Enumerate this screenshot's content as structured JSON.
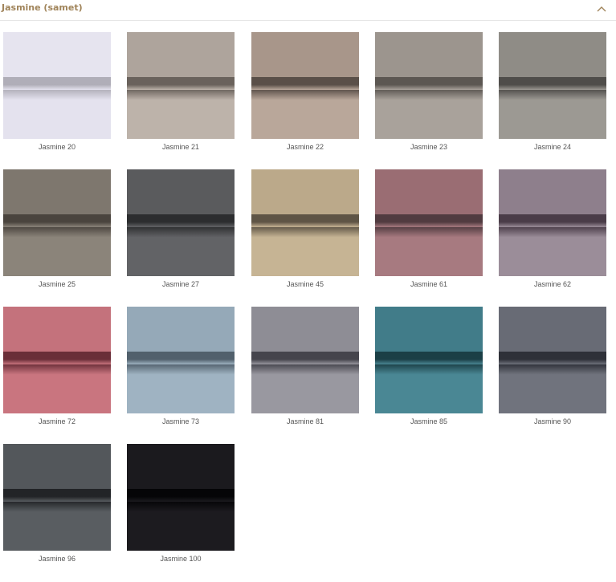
{
  "section": {
    "title": "Jasmine (samet)",
    "accent_color": "#a0845a",
    "collapse_icon": "chevron-up-icon"
  },
  "swatches": [
    {
      "label": "Jasmine 20",
      "top": "#e6e4ef",
      "band": "#b0aeb8",
      "bottom": "#e4e2ee"
    },
    {
      "label": "Jasmine 21",
      "top": "#aea49c",
      "band": "#6a625c",
      "bottom": "#bdb3aa"
    },
    {
      "label": "Jasmine 22",
      "top": "#a8968a",
      "band": "#5a4f48",
      "bottom": "#b9a79a"
    },
    {
      "label": "Jasmine 23",
      "top": "#9c958e",
      "band": "#5c5752",
      "bottom": "#a9a29b"
    },
    {
      "label": "Jasmine 24",
      "top": "#8f8c86",
      "band": "#4f4d4a",
      "bottom": "#9c9993"
    },
    {
      "label": "Jasmine 25",
      "top": "#7e776e",
      "band": "#4a443e",
      "bottom": "#8b847a"
    },
    {
      "label": "Jasmine 27",
      "top": "#5a5b5d",
      "band": "#2c2d2f",
      "bottom": "#626366"
    },
    {
      "label": "Jasmine 45",
      "top": "#bba98a",
      "band": "#5e5445",
      "bottom": "#c6b494"
    },
    {
      "label": "Jasmine 61",
      "top": "#9a6d73",
      "band": "#513b40",
      "bottom": "#a77a80"
    },
    {
      "label": "Jasmine 62",
      "top": "#8e7f8c",
      "band": "#4a3c48",
      "bottom": "#9b8d99"
    },
    {
      "label": "Jasmine 72",
      "top": "#c4727c",
      "band": "#6a2e38",
      "bottom": "#c9757f"
    },
    {
      "label": "Jasmine 73",
      "top": "#95a9b8",
      "band": "#51606c",
      "bottom": "#9fb3c2"
    },
    {
      "label": "Jasmine 81",
      "top": "#8e8d95",
      "band": "#45444c",
      "bottom": "#9998a0"
    },
    {
      "label": "Jasmine 85",
      "top": "#417c89",
      "band": "#1b3f46",
      "bottom": "#4a8794"
    },
    {
      "label": "Jasmine 90",
      "top": "#686b75",
      "band": "#2e3038",
      "bottom": "#70737d"
    },
    {
      "label": "Jasmine 96",
      "top": "#53575b",
      "band": "#222427",
      "bottom": "#595d61"
    },
    {
      "label": "Jasmine 100",
      "top": "#1b1a1e",
      "band": "#050507",
      "bottom": "#1c1b1f"
    }
  ]
}
